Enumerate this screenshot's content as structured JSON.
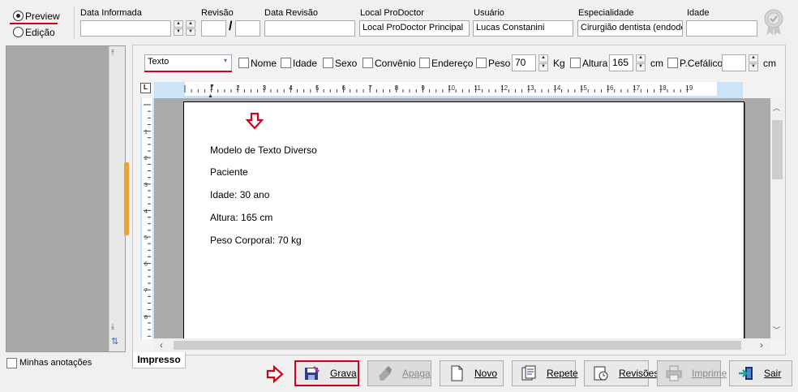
{
  "mode": {
    "preview_label": "Preview",
    "edit_label": "Edição",
    "selected": "preview"
  },
  "header": {
    "data_informada_label": "Data Informada",
    "data_informada_value": "",
    "revisao_label": "Revisão",
    "revisao_value": "",
    "revisao_sep": "/",
    "revisao_total": "",
    "data_revisao_label": "Data Revisão",
    "data_revisao_value": "",
    "local_label": "Local ProDoctor",
    "local_value": "Local ProDoctor Principal",
    "usuario_label": "Usuário",
    "usuario_value": "Lucas Constanini",
    "especialidade_label": "Especialidade",
    "especialidade_value": "Cirurgião dentista (endodo",
    "idade_label": "Idade",
    "idade_value": ""
  },
  "toolbar": {
    "type_select": "Texto",
    "checks": [
      {
        "label": "Nome"
      },
      {
        "label": "Idade"
      },
      {
        "label": "Sexo"
      },
      {
        "label": "Convênio"
      },
      {
        "label": "Endereço"
      },
      {
        "label": "Peso"
      }
    ],
    "peso_value": "70",
    "peso_unit": "Kg",
    "altura_label": "Altura",
    "altura_value": "165",
    "altura_unit": "cm",
    "pcefalico_label": "P.Cefálico",
    "pcefalico_value": "",
    "pcefalico_unit": "cm"
  },
  "document": {
    "lines": [
      "Modelo de Texto Diverso",
      "Paciente",
      "Idade: 30 ano",
      "Altura: 165 cm",
      "Peso Corporal: 70 kg"
    ]
  },
  "ruler": {
    "numbers": [
      "1",
      "2",
      "3",
      "4",
      "5",
      "6",
      "7",
      "8",
      "9",
      "10",
      "11",
      "12",
      "13",
      "14",
      "15",
      "16",
      "17",
      "18",
      "19"
    ]
  },
  "left_panel": {
    "notes_label": "Minhas anotações"
  },
  "tab": {
    "label": "Impresso"
  },
  "buttons": {
    "grava": "Grava",
    "apaga": "Apaga",
    "novo": "Novo",
    "repete": "Repete",
    "revisoes": "Revisões",
    "imprime": "Imprime",
    "sair": "Sair"
  },
  "colors": {
    "accent_red": "#d0021b",
    "highlight_blue": "#cde3f7"
  }
}
